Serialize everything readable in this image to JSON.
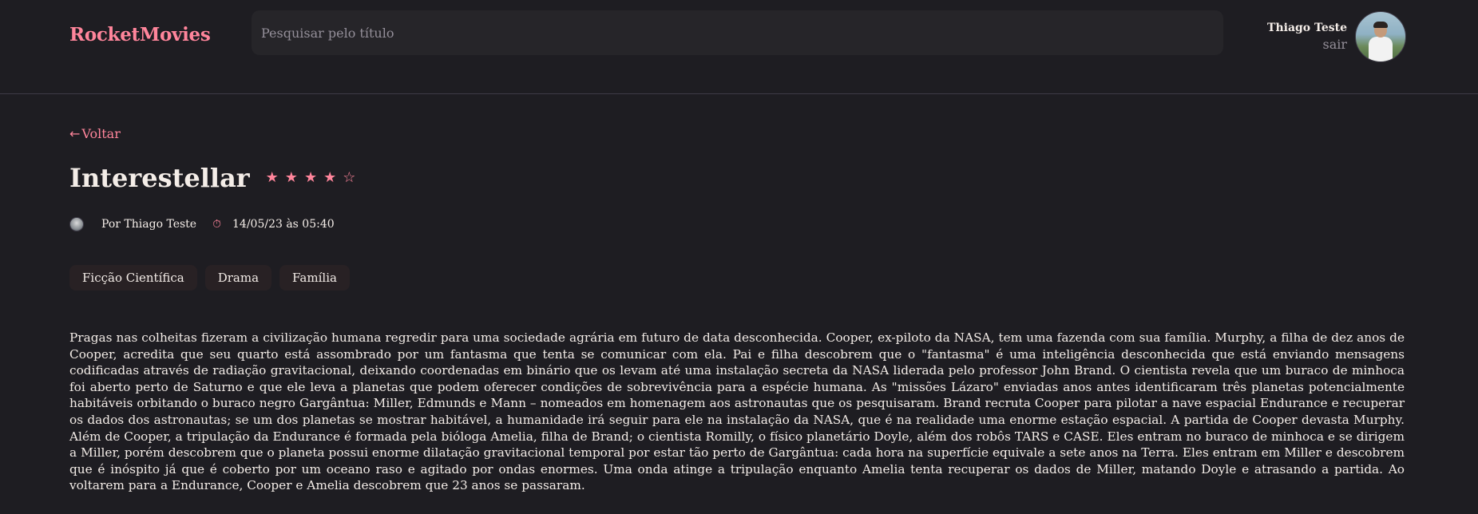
{
  "header": {
    "brand": "RocketMovies",
    "search_placeholder": "Pesquisar pelo título",
    "user_name": "Thiago Teste",
    "logout_label": "sair"
  },
  "movie": {
    "back_label": "Voltar",
    "back_icon": "arrow-left-icon",
    "title": "Interestellar",
    "rating": 4,
    "rating_max": 5,
    "stars": [
      "★",
      "★",
      "★",
      "★",
      "☆"
    ],
    "author": "Por Thiago Teste",
    "clock_icon": "clock-icon",
    "clock_glyph": "⏱",
    "date": "14/05/23 às 05:40",
    "tags": [
      "Ficção Científica",
      "Drama",
      "Família"
    ],
    "description": "Pragas nas colheitas fizeram a civilização humana regredir para uma sociedade agrária em futuro de data desconhecida. Cooper, ex-piloto da NASA, tem uma fazenda com sua família. Murphy, a filha de dez anos de Cooper, acredita que seu quarto está assombrado por um fantasma que tenta se comunicar com ela. Pai e filha descobrem que o \"fantasma\" é uma inteligência desconhecida que está enviando mensagens codificadas através de radiação gravitacional, deixando coordenadas em binário que os levam até uma instalação secreta da NASA liderada pelo professor John Brand. O cientista revela que um buraco de minhoca foi aberto perto de Saturno e que ele leva a planetas que podem oferecer condições de sobrevivência para a espécie humana. As \"missões Lázaro\" enviadas anos antes identificaram três planetas potencialmente habitáveis orbitando o buraco negro Gargântua: Miller, Edmunds e Mann – nomeados em homenagem aos astronautas que os pesquisaram. Brand recruta Cooper para pilotar a nave espacial Endurance e recuperar os dados dos astronautas; se um dos planetas se mostrar habitável, a humanidade irá seguir para ele na instalação da NASA, que é na realidade uma enorme estação espacial. A partida de Cooper devasta Murphy. Além de Cooper, a tripulação da Endurance é formada pela bióloga Amelia, filha de Brand; o cientista Romilly, o físico planetário Doyle, além dos robôs TARS e CASE. Eles entram no buraco de minhoca e se dirigem a Miller, porém descobrem que o planeta possui enorme dilatação gravitacional temporal por estar tão perto de Gargântua: cada hora na superfície equivale a sete anos na Terra. Eles entram em Miller e descobrem que é inóspito já que é coberto por um oceano raso e agitado por ondas enormes. Uma onda atinge a tripulação enquanto Amelia tenta recuperar os dados de Miller, matando Doyle e atrasando a partida. Ao voltarem para a Endurance, Cooper e Amelia descobrem que 23 anos se passaram."
  },
  "colors": {
    "background": "#1e1d22",
    "accent": "#ff859b",
    "input_bg": "#262529",
    "tag_bg": "#282124",
    "text": "#f4ede8",
    "muted": "#948f99"
  }
}
